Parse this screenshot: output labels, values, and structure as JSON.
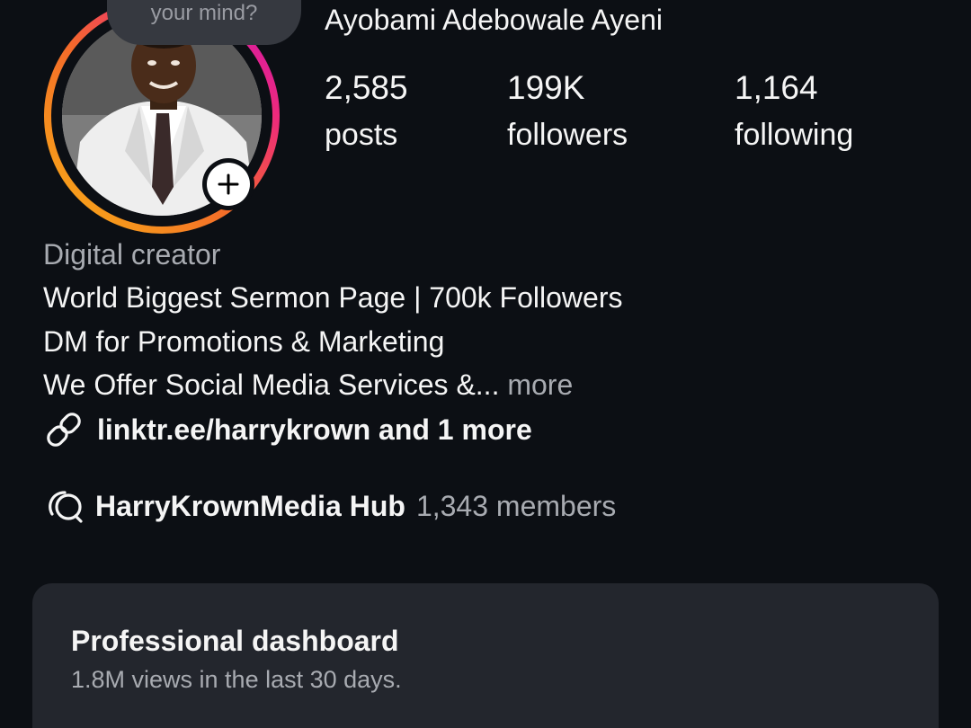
{
  "profile": {
    "note_text": "your mind?",
    "display_name": "Ayobami Adebowale Ayeni",
    "stats": [
      {
        "value": "2,585",
        "label": "posts"
      },
      {
        "value": "199K",
        "label": "followers"
      },
      {
        "value": "1,164",
        "label": "following"
      }
    ]
  },
  "bio": {
    "category": "Digital creator",
    "lines": [
      "World Biggest Sermon Page | 700k Followers",
      "DM for Promotions & Marketing",
      "We Offer Social Media Services &..."
    ],
    "more_label": "more",
    "link_text": "linktr.ee/harrykrown and 1 more"
  },
  "channel": {
    "name": "HarryKrownMedia Hub",
    "members": "1,343 members"
  },
  "dashboard": {
    "title": "Professional dashboard",
    "subtitle": "1.8M views in the last 30 days."
  },
  "icons": {
    "add_story": "plus-icon",
    "link": "link-icon",
    "channel": "broadcast-channel-icon"
  },
  "colors": {
    "background": "#0c0f14",
    "card": "#23262d",
    "secondary_text": "#a8abb1",
    "ring_start": "#f9a825",
    "ring_mid": "#f5407a",
    "ring_end": "#c913b9"
  }
}
